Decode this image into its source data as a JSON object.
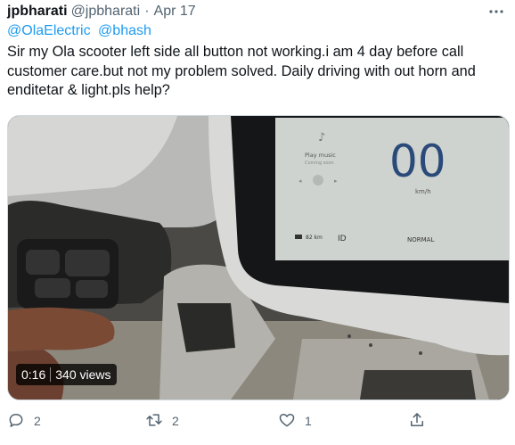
{
  "tweet": {
    "author_name": "jpbharati",
    "author_handle": "@jpbharati",
    "separator": "·",
    "date": "Apr 17",
    "mentions": [
      "@OlaElectric",
      "@bhash"
    ],
    "text": "Sir my Ola scooter left side all button not working.i am 4 day before call customer care.but not my problem solved. Daily driving with out horn and enditetar & light.pls help?"
  },
  "media": {
    "duration": "0:16",
    "views": "340 views",
    "screen": {
      "music_label": "Play music",
      "music_sub": "Coming soon",
      "speed": "00",
      "speed_unit": "km/h",
      "range": "82 km",
      "mode": "NORMAL"
    }
  },
  "actions": {
    "reply_count": "2",
    "retweet_count": "2",
    "like_count": "1"
  },
  "icons": {
    "more": "more-icon",
    "reply": "reply-icon",
    "retweet": "retweet-icon",
    "like": "like-icon",
    "share": "share-icon"
  },
  "colors": {
    "link": "#1d9bf0",
    "muted": "#536471",
    "text": "#0f1419"
  }
}
